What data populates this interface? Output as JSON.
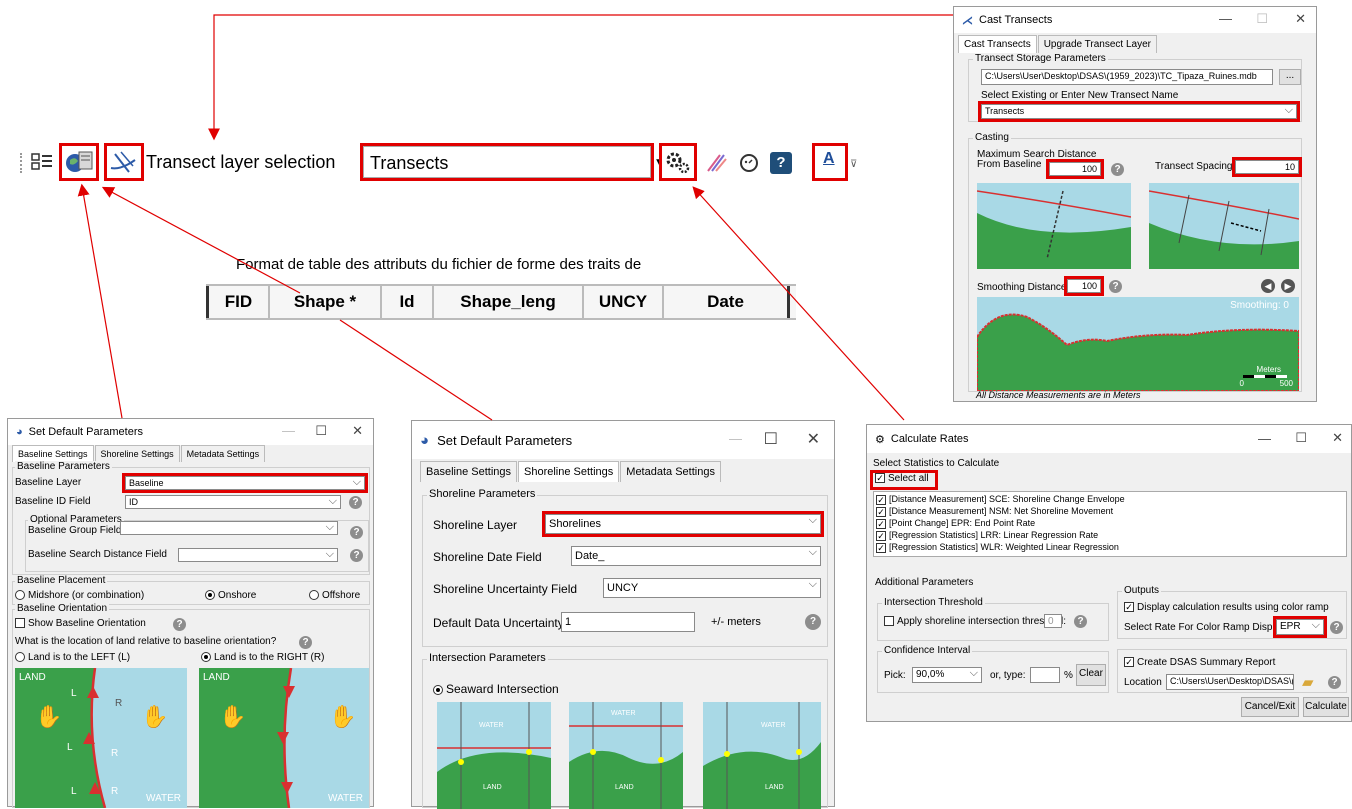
{
  "toolbar": {
    "layer_label": "Transect layer selection",
    "layer_value": "Transects",
    "help_glyph": "?",
    "text_glyph": "A"
  },
  "caption": "Format de table des attributs du fichier de forme des traits de",
  "attr_table": {
    "headers": [
      "FID",
      "Shape *",
      "Id",
      "Shape_leng",
      "UNCY",
      "Date"
    ]
  },
  "cast": {
    "title": "Cast Transects",
    "tabs": [
      "Cast Transects",
      "Upgrade Transect Layer"
    ],
    "storage_group": "Transect Storage Parameters",
    "path": "C:\\Users\\User\\Desktop\\DSAS\\(1959_2023)\\TC_Tipaza_Ruines.mdb",
    "browse": "...",
    "name_label": "Select Existing or Enter New Transect Name",
    "name_value": "Transects",
    "casting_group": "Casting",
    "max_search_label1": "Maximum Search Distance",
    "max_search_label2": "From Baseline",
    "max_search_value": "100",
    "spacing_label": "Transect Spacing",
    "spacing_value": "10",
    "smoothing_label": "Smoothing Distance",
    "smoothing_value": "100",
    "smoothing_caption": "Smoothing: 0",
    "scale_label": "Meters",
    "scale_min": "0",
    "scale_max": "500",
    "footer": "All Distance Measurements are in Meters"
  },
  "baseline_win": {
    "title": "Set Default Parameters",
    "tabs": [
      "Baseline Settings",
      "Shoreline Settings",
      "Metadata Settings"
    ],
    "params_group": "Baseline Parameters",
    "layer_label": "Baseline Layer",
    "layer_value": "Baseline",
    "id_label": "Baseline ID Field",
    "id_value": "ID",
    "optional_group": "Optional Parameters",
    "group_label": "Baseline Group Field",
    "search_label": "Baseline Search Distance Field",
    "placement_group": "Baseline Placement",
    "placement_options": [
      "Midshore (or combination)",
      "Onshore",
      "Offshore"
    ],
    "orientation_group": "Baseline Orientation",
    "show_orientation": "Show Baseline Orientation",
    "question": "What is the location of land relative to baseline orientation?",
    "left_option": "Land is to the LEFT (L)",
    "right_option": "Land is to the RIGHT (R)",
    "land": "LAND",
    "water": "WATER",
    "L": "L",
    "R": "R"
  },
  "shoreline_win": {
    "title": "Set Default Parameters",
    "tabs": [
      "Baseline Settings",
      "Shoreline Settings",
      "Metadata Settings"
    ],
    "params_group": "Shoreline Parameters",
    "layer_label": "Shoreline Layer",
    "layer_value": "Shorelines",
    "date_label": "Shoreline Date Field",
    "date_value": "Date_",
    "uncy_label": "Shoreline Uncertainty Field",
    "uncy_value": "UNCY",
    "default_label": "Default Data Uncertainty",
    "default_value": "1",
    "default_unit": "+/- meters",
    "intersection_group": "Intersection Parameters",
    "seaward": "Seaward Intersection",
    "water": "WATER",
    "land": "LAND"
  },
  "rates_win": {
    "title": "Calculate Rates",
    "stats_group": "Select Statistics to Calculate",
    "select_all": "Select all",
    "stats": [
      "[Distance Measurement] SCE: Shoreline Change Envelope",
      "[Distance Measurement] NSM: Net Shoreline Movement",
      "[Point Change] EPR: End Point Rate",
      "[Regression Statistics] LRR: Linear Regression Rate",
      "[Regression Statistics] WLR: Weighted Linear Regression"
    ],
    "additional": "Additional Parameters",
    "threshold_group": "Intersection Threshold",
    "threshold_label": "Apply shoreline intersection threshold:",
    "threshold_value": "0",
    "confidence_group": "Confidence Interval",
    "pick_label": "Pick:",
    "pick_value": "90,0%",
    "or_type": "or, type:",
    "percent": "%",
    "clear": "Clear",
    "outputs_group": "Outputs",
    "display_label": "Display calculation results using color ramp",
    "ramp_label": "Select Rate For Color Ramp Displa",
    "ramp_value": "EPR",
    "summary_label": "Create DSAS Summary Report",
    "location_label": "Location",
    "location_value": "C:\\Users\\User\\Desktop\\DSAS\\(",
    "cancel": "Cancel/Exit",
    "calculate": "Calculate"
  },
  "colors": {
    "highlight": "#e00000",
    "water": "#a9d9e6",
    "land": "#3aa04a",
    "shore": "#d93030"
  }
}
